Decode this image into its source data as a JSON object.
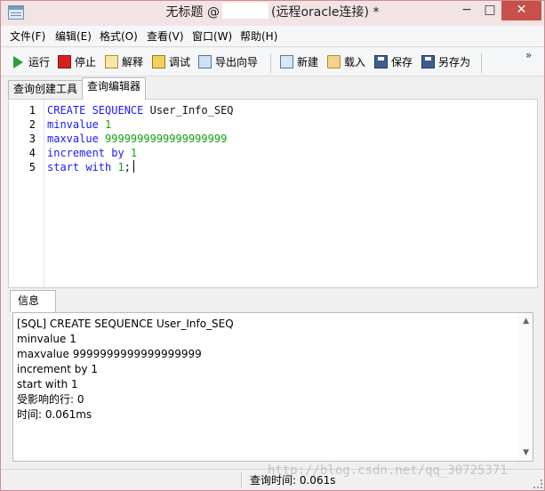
{
  "window": {
    "title_prefix": "无标题 @",
    "title_suffix": "(远程oracle连接) *",
    "minimize": "−",
    "maximize": "□",
    "close": "✕"
  },
  "menu": [
    "文件(F)",
    "编辑(E)",
    "格式(O)",
    "查看(V)",
    "窗口(W)",
    "帮助(H)"
  ],
  "toolbar": {
    "run": "运行",
    "stop": "停止",
    "explain": "解释",
    "debug": "调试",
    "export_wizard": "导出向导",
    "new": "新建",
    "load": "载入",
    "save": "保存",
    "save_as": "另存为",
    "more": "»"
  },
  "tabs": [
    "查询创建工具",
    "查询编辑器"
  ],
  "active_tab": "查询编辑器",
  "editor": {
    "line_numbers": [
      "1",
      "2",
      "3",
      "4",
      "5"
    ],
    "lines": [
      [
        {
          "t": "CREATE SEQUENCE ",
          "c": "kw"
        },
        {
          "t": "User_Info_SEQ",
          "c": "plain"
        }
      ],
      [
        {
          "t": "minvalue ",
          "c": "kw"
        },
        {
          "t": "1",
          "c": "num"
        }
      ],
      [
        {
          "t": "maxvalue ",
          "c": "kw"
        },
        {
          "t": "9999999999999999999",
          "c": "num"
        }
      ],
      [
        {
          "t": "increment by ",
          "c": "kw"
        },
        {
          "t": "1",
          "c": "num"
        }
      ],
      [
        {
          "t": "start with ",
          "c": "kw"
        },
        {
          "t": "1",
          "c": "num"
        },
        {
          "t": ";",
          "c": "plain"
        }
      ]
    ]
  },
  "info": {
    "tab_label": "信息",
    "lines": [
      "[SQL] CREATE SEQUENCE User_Info_SEQ",
      "minvalue 1",
      "maxvalue 9999999999999999999",
      "increment by 1",
      "start with 1",
      "受影响的行: 0",
      "时间: 0.061ms"
    ]
  },
  "status": {
    "query_time": "查询时间: 0.061s",
    "watermark": "http://blog.csdn.net/qq_30725371"
  },
  "colors": {
    "keyword": "#1a1aff",
    "number": "#15a015",
    "close_button": "#c7504b",
    "title_bar": "#f2e4e4"
  }
}
